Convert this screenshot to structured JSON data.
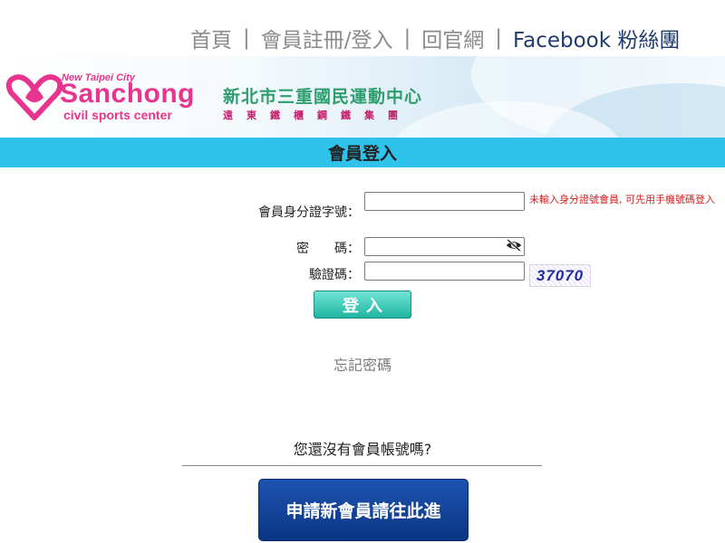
{
  "nav": {
    "items": [
      "首頁",
      "會員註冊/登入",
      "回官網",
      "Facebook 粉絲團"
    ],
    "separator": "|"
  },
  "banner": {
    "logo_small": "New Taipei City",
    "logo_main": "Sanchong",
    "logo_sub": "civil sports center",
    "title_zh": "新北市三重國民運動中心",
    "operator_zh": "遠東鐵櫃鋼鐵集團",
    "brand_color": "#e8348e"
  },
  "page_title": "會員登入",
  "form": {
    "id_label": "會員身分證字號：",
    "id_value": "",
    "id_hint": "未輸入身分證號會員, 可先用手機號碼登入",
    "password_label": "密　　碼：",
    "password_value": "",
    "password_toggle_icon": "eye-slash-icon",
    "captcha_label": "驗證碼：",
    "captcha_value": "",
    "captcha_text": "37070",
    "login_button": "登入",
    "forgot_link": "忘記密碼"
  },
  "signup": {
    "prompt": "您還沒有會員帳號嗎?",
    "button": "申請新會員請往此進"
  },
  "colors": {
    "title_bar": "#2fc2ea",
    "login_button": "#1fb6a2",
    "signup_button": "#0b3583",
    "hint_text": "#d21f1f"
  }
}
